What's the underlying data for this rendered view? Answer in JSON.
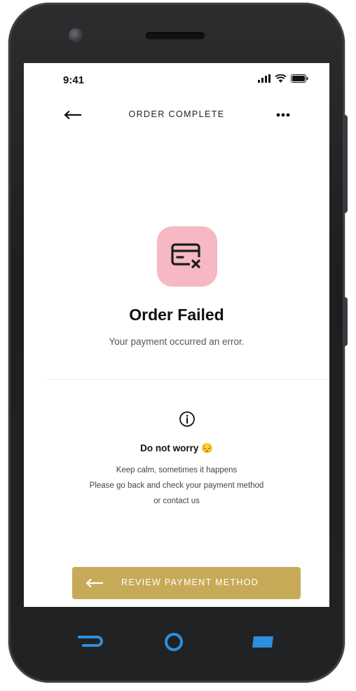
{
  "status_bar": {
    "time": "9:41",
    "icons": [
      "cellular-signal-icon",
      "wifi-icon",
      "battery-icon"
    ]
  },
  "nav": {
    "back_icon": "arrow-left-icon",
    "title": "ORDER COMPLETE",
    "more_icon": "more-horizontal-icon"
  },
  "result": {
    "icon": "payment-failed-icon",
    "title": "Order Failed",
    "subtitle": "Your payment occurred an error."
  },
  "help": {
    "icon": "info-icon",
    "title": "Do not worry 😔",
    "lines": [
      "Keep calm, sometimes it happens",
      "Please go back and check your payment method",
      "or contact us"
    ]
  },
  "cta": {
    "icon": "arrow-left-icon",
    "label": "REVIEW PAYMENT METHOD"
  },
  "device_softkeys": [
    "back-softkey-icon",
    "home-softkey-icon",
    "recents-softkey-icon"
  ],
  "colors": {
    "badge_bg": "#f6b8c2",
    "cta_bg": "#c7aa58",
    "softkey_blue": "#2d8fe0"
  }
}
